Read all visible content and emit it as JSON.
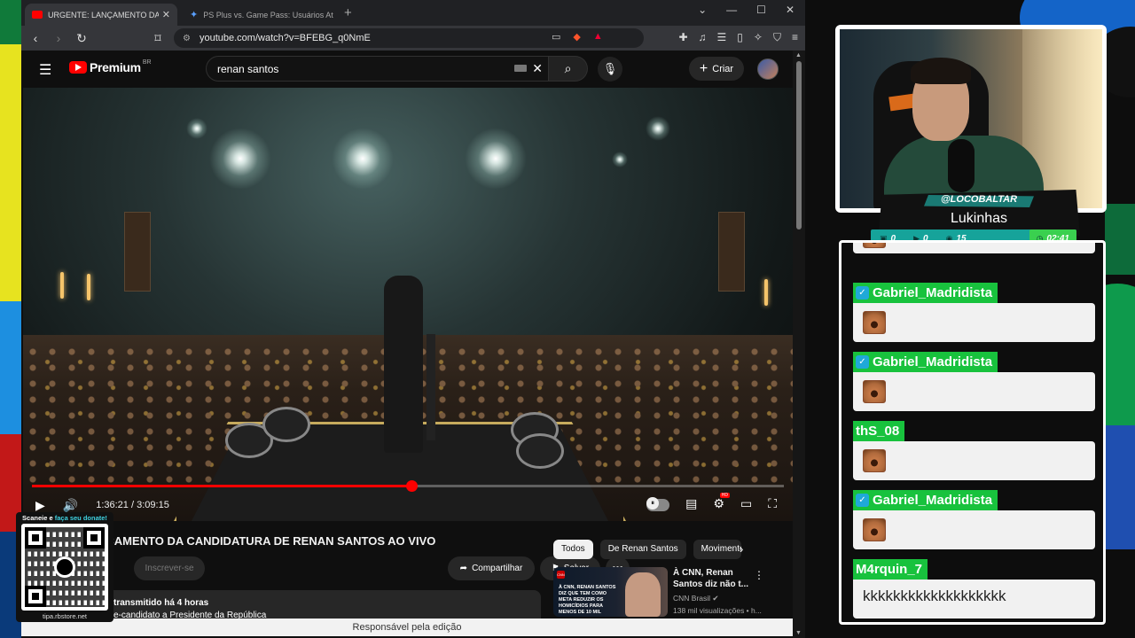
{
  "browser": {
    "tabs": [
      {
        "title": "URGENTE: LANÇAMENTO DA CANDIDATU",
        "active": true
      },
      {
        "title": "PS Plus vs. Game Pass: Usuários Ativos - Gem",
        "active": false
      }
    ],
    "url": "youtube.com/watch?v=BFEBG_q0NmE",
    "brave_shield_count": "89+"
  },
  "youtube": {
    "logo": "Premium",
    "region": "BR",
    "search_query": "renan santos",
    "create_label": "Criar",
    "player": {
      "current_time": "1:36:21",
      "separator": "/",
      "duration": "3:09:15",
      "progress_fraction": 0.505,
      "hd_badge": "HD"
    },
    "video": {
      "title": "LANÇAMENTO DA CANDIDATURA DE RENAN SANTOS AO VIVO",
      "visible_title": "NÇAMENTO DA CANDIDATURA DE RENAN SANTOS AO VIVO",
      "subscribe_label": "Inscrever-se",
      "share_label": "Compartilhar",
      "save_label": "Salvar",
      "desc_meta": "transmitido há 4 horas",
      "desc_line": "e-candidato a Presidente da República"
    },
    "chips": [
      "Todos",
      "De Renan Santos",
      "Movimento"
    ],
    "recommendation": {
      "title": "À CNN, Renan Santos diz não t...",
      "channel": "CNN Brasil",
      "views": "138 mil visualizações • h...",
      "thumb_headline": "À CNN, RENAN SANTOS DIZ QUE TEM COMO META REDUZIR OS HOMICÍDIOS PARA MENOS DE 10 MIL"
    },
    "caption": "Responsável pela edição"
  },
  "overlay": {
    "qr_caption_start": "Scaneie e ",
    "qr_caption_highlight": "faça seu donate!",
    "qr_url": "tipa.rbstore.net",
    "handle": "@LOCOBALTAR",
    "name": "Lukinhas",
    "stats": {
      "chat": "0",
      "youtube": "0",
      "viewers": "15",
      "timer": "02:41"
    }
  },
  "chat": {
    "messages": [
      {
        "user": "Gabriel_Madridista",
        "verified": true,
        "content_type": "emote",
        "text": ""
      },
      {
        "user": "Gabriel_Madridista",
        "verified": true,
        "content_type": "emote",
        "text": ""
      },
      {
        "user": "thS_08",
        "verified": false,
        "content_type": "emote",
        "text": ""
      },
      {
        "user": "Gabriel_Madridista",
        "verified": true,
        "content_type": "emote",
        "text": ""
      },
      {
        "user": "M4rquin_7",
        "verified": false,
        "content_type": "text",
        "text": "kkkkkkkkkkkkkkkkkkk"
      }
    ]
  },
  "colors": {
    "youtube_red": "#ff0000",
    "chat_user_bg": "#18c23d",
    "stats_bar": "#16a39a",
    "timer_bg": "#3ad04f"
  }
}
